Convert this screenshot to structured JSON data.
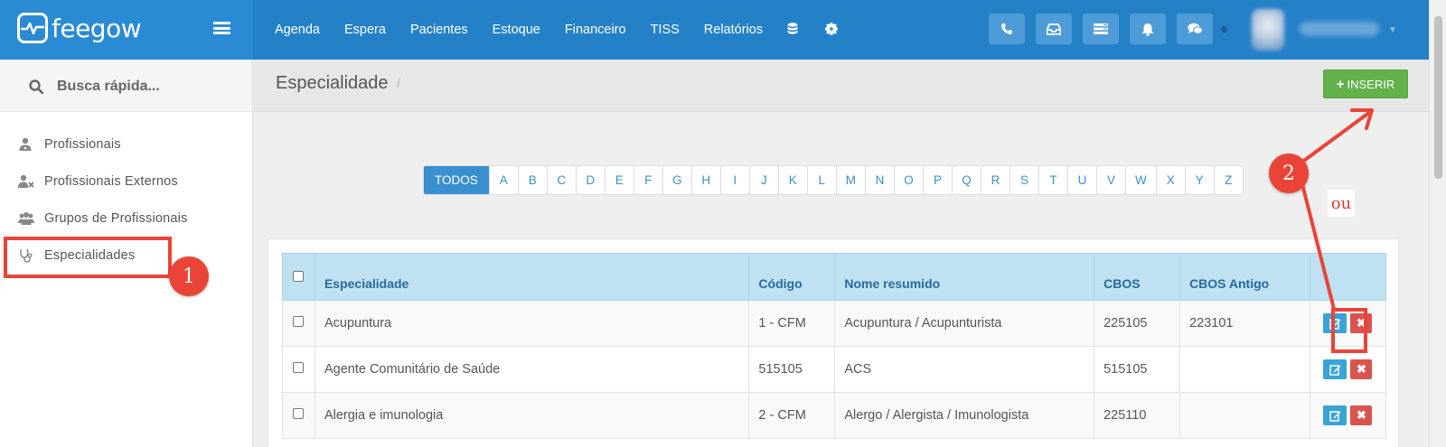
{
  "app": {
    "logo_text": "feegow"
  },
  "nav": {
    "items": [
      "Agenda",
      "Espera",
      "Pacientes",
      "Estoque",
      "Financeiro",
      "TISS",
      "Relatórios"
    ],
    "extra_icons": [
      "database-icon",
      "gear-icon"
    ]
  },
  "toolbar_icons": [
    "phone-icon",
    "inbox-icon",
    "list-icon",
    "bell-icon",
    "chat-icon"
  ],
  "search": {
    "placeholder": "Busca rápida..."
  },
  "sidebar": {
    "items": [
      {
        "label": "Profissionais",
        "icon": "user-md-icon"
      },
      {
        "label": "Profissionais Externos",
        "icon": "user-times-icon"
      },
      {
        "label": "Grupos de Profissionais",
        "icon": "users-icon"
      },
      {
        "label": "Especialidades",
        "icon": "stethoscope-icon"
      }
    ]
  },
  "page": {
    "title": "Especialidade",
    "separator": "/",
    "insert_plus": "+",
    "insert_label": "INSERIR"
  },
  "alphabet": [
    "TODOS",
    "A",
    "B",
    "C",
    "D",
    "E",
    "F",
    "G",
    "H",
    "I",
    "J",
    "K",
    "L",
    "M",
    "N",
    "O",
    "P",
    "Q",
    "R",
    "S",
    "T",
    "U",
    "V",
    "W",
    "X",
    "Y",
    "Z"
  ],
  "table": {
    "headers": [
      "Especialidade",
      "Código",
      "Nome resumido",
      "CBOS",
      "CBOS Antigo"
    ],
    "rows": [
      {
        "especialidade": "Acupuntura",
        "codigo": "1 - CFM",
        "nome_resumido": "Acupuntura / Acupunturista",
        "cbos": "225105",
        "cbos_antigo": "223101"
      },
      {
        "especialidade": "Agente Comunitário de Saúde",
        "codigo": "515105",
        "nome_resumido": "ACS",
        "cbos": "515105",
        "cbos_antigo": ""
      },
      {
        "especialidade": "Alergia e imunologia",
        "codigo": "2 - CFM",
        "nome_resumido": "Alergo / Alergista / Imunologista",
        "cbos": "225110",
        "cbos_antigo": ""
      }
    ],
    "delete_glyph": "✖"
  },
  "annotations": {
    "badge_1": "1",
    "badge_2": "2",
    "ou": "ou"
  },
  "colors": {
    "topbar": "#2481c8",
    "brand": "#2a8bd4",
    "insert": "#62b14a",
    "header_row": "#bfe1f2",
    "annotation_red": "#e94437"
  }
}
